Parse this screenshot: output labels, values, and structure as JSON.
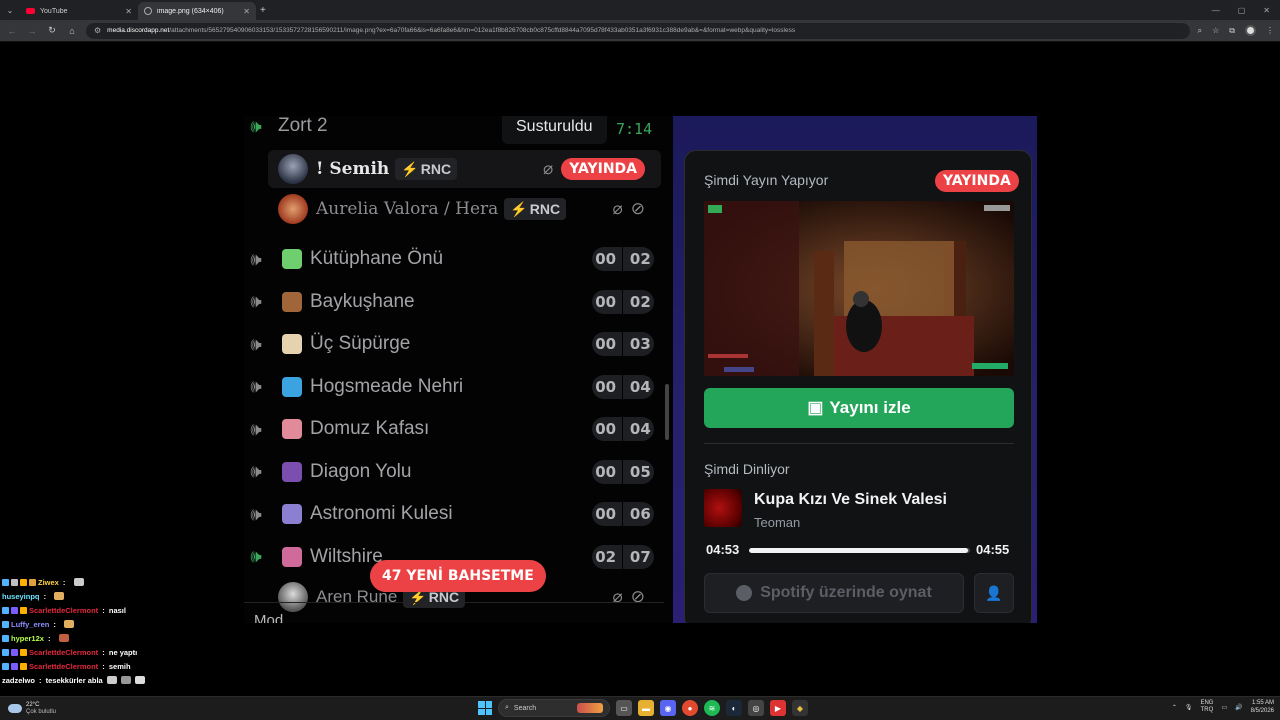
{
  "browser": {
    "tabs": [
      {
        "title": "YouTube",
        "active": false
      },
      {
        "title": "image.png (634×406)",
        "active": true
      }
    ],
    "url_host": "media.discordapp.net",
    "url_path": "/attachments/565279540906033153/1533572728156590211/image.png?ex=6a70fa66&is=6a6fa8e6&hm=012ea1f8b826708cb0c875cffd8844a7095d78f433ab0351a3f6931c388de9ab&=&format=webp&quality=lossless"
  },
  "discord": {
    "tooltip": "Susturuldu",
    "timer": "7:14",
    "active_channel": "Zort 2",
    "users": [
      {
        "name": "! Semih",
        "tag": "RNC",
        "live": "YAYINDA",
        "color": "#e6e6e6"
      },
      {
        "name": "Aurelia Valora / Hera",
        "tag": "RNC",
        "color": "#8c8c92"
      },
      {
        "name": "Aren Rune",
        "tag": "RNC",
        "color": "#8c8c92"
      }
    ],
    "channels": [
      {
        "name": "Kütüphane Önü",
        "a": "00",
        "b": "02",
        "emoji_color": "#6fcf6f"
      },
      {
        "name": "Baykuşhane",
        "a": "00",
        "b": "02",
        "emoji_color": "#a0663a"
      },
      {
        "name": "Üç Süpürge",
        "a": "00",
        "b": "03",
        "emoji_color": "#e5d3b0"
      },
      {
        "name": "Hogsmeade Nehri",
        "a": "00",
        "b": "04",
        "emoji_color": "#3aa3e0"
      },
      {
        "name": "Domuz Kafası",
        "a": "00",
        "b": "04",
        "emoji_color": "#e08a9a"
      },
      {
        "name": "Diagon Yolu",
        "a": "00",
        "b": "05",
        "emoji_color": "#7a4fb0"
      },
      {
        "name": "Astronomi Kulesi",
        "a": "00",
        "b": "06",
        "emoji_color": "#8a7fd0"
      },
      {
        "name": "Wiltshire",
        "a": "02",
        "b": "07",
        "emoji_color": "#d06a9a"
      }
    ],
    "mention_pill": "47 YENİ BAHSETME",
    "bottom_partial": "Mod"
  },
  "panel": {
    "stream_header": "Şimdi Yayın Yapıyor",
    "live_badge": "YAYINDA",
    "watch_button": "Yayını izle",
    "listening_header": "Şimdi Dinliyor",
    "song": "Kupa Kızı Ve Sinek Valesi",
    "artist": "Teoman",
    "elapsed": "04:53",
    "duration": "04:55",
    "progress_fraction": 0.993,
    "spotify_button": "Spotify üzerinde oynat"
  },
  "chat": [
    {
      "user": "Ziwex",
      "color": "#ffd24a",
      "msg": "",
      "badges": [
        "#4fb3ff",
        "#c0c0c0",
        "#ffb000",
        "#e0a040"
      ],
      "emotes": [
        "#cccccc"
      ]
    },
    {
      "user": "huseyinpq",
      "color": "#6fe0ff",
      "msg": "",
      "badges": [],
      "emotes": [
        "#e0b060"
      ]
    },
    {
      "user": "ScarlettdeClermont",
      "color": "#e0293b",
      "msg": "nasıl",
      "badges": [
        "#4fb3ff",
        "#7a5cff",
        "#ffb000"
      ],
      "emotes": []
    },
    {
      "user": "Luffy_eren",
      "color": "#8f8fff",
      "msg": "",
      "badges": [
        "#4fb3ff"
      ],
      "emotes": [
        "#e0b060"
      ]
    },
    {
      "user": "hyper12x",
      "color": "#b8ff4a",
      "msg": "",
      "badges": [
        "#4fb3ff"
      ],
      "emotes": [
        "#c06040"
      ]
    },
    {
      "user": "ScarlettdeClermont",
      "color": "#e0293b",
      "msg": "ne yaptı",
      "badges": [
        "#4fb3ff",
        "#7a5cff",
        "#ffb000"
      ],
      "emotes": []
    },
    {
      "user": "ScarlettdeClermont",
      "color": "#e0293b",
      "msg": "semih",
      "badges": [
        "#4fb3ff",
        "#7a5cff",
        "#ffb000"
      ],
      "emotes": []
    },
    {
      "user": "zadzelwo",
      "color": "#ffffff",
      "msg": "tesekkürler abla",
      "badges": [],
      "emotes": [
        "#cccccc",
        "#999999",
        "#dddddd"
      ]
    }
  ],
  "taskbar": {
    "temp": "22°C",
    "weather": "Çok bulutlu",
    "search": "Search",
    "lang1": "ENG",
    "lang2": "TRQ",
    "time": "1:55 AM",
    "date": "8/5/2026"
  }
}
